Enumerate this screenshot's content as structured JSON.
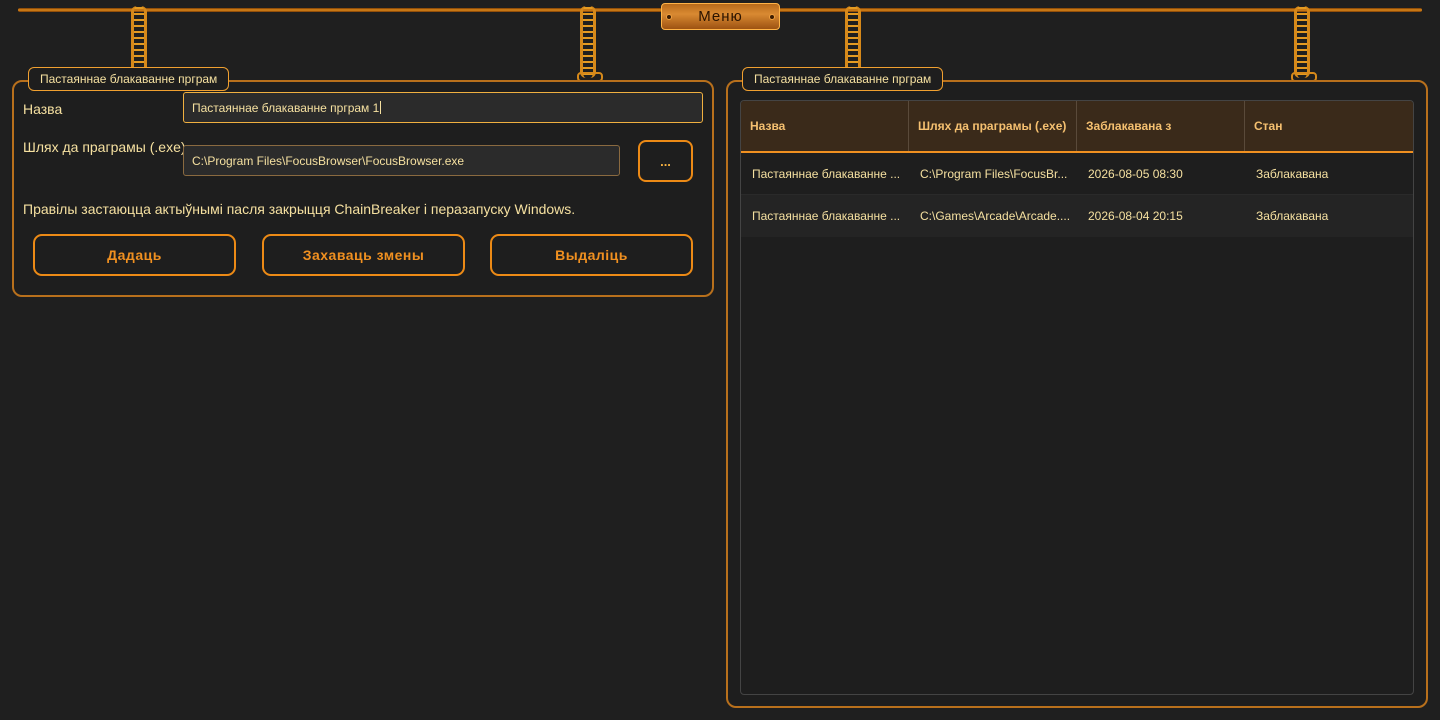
{
  "menu": {
    "label": "Меню"
  },
  "editor": {
    "title": "Пастаяннае блакаванне прграм",
    "name_label": "Назва",
    "name_value": "Пастаяннае блакаванне прграм 1",
    "path_label": "Шлях да праграмы (.exe)",
    "path_value": "C:\\Program Files\\FocusBrowser\\FocusBrowser.exe",
    "browse_label": "...",
    "note": "Правілы застаюцца актыўнымі пасля закрыцця ChainBreaker і перазапуску Windows.",
    "buttons": {
      "add": "Дадаць",
      "save": "Захаваць змены",
      "delete": "Выдаліць"
    }
  },
  "list": {
    "title": "Пастаяннае блакаванне прграм",
    "columns": [
      "Назва",
      "Шлях да праграмы (.exe)",
      "Заблакавана з",
      "Стан"
    ],
    "rows": [
      [
        "Пастаяннае блакаванне ...",
        "C:\\Program Files\\FocusBr...",
        "2026-08-05 08:30",
        "Заблакавана"
      ],
      [
        "Пастаяннае блакаванне ...",
        "C:\\Games\\Arcade\\Arcade....",
        "2026-08-04 20:15",
        "Заблакавана"
      ]
    ]
  },
  "colors": {
    "accent": "#ec8a16",
    "background": "#1f1f1f",
    "text": "#f5e0a0"
  }
}
